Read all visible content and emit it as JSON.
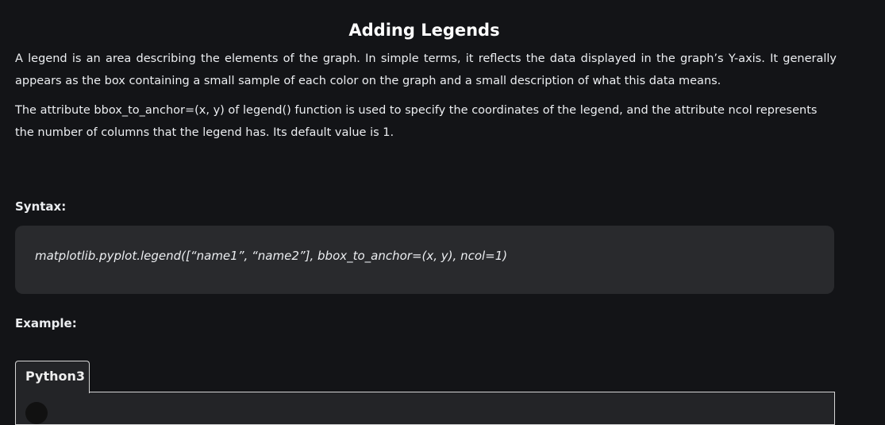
{
  "heading": "Adding Legends",
  "paragraphs": [
    "A legend is an area describing the elements of the graph. In simple terms, it reflects the data displayed in the graph’s Y-axis. It generally appears as the box containing a small sample of each color on the graph and a small description of what this data means.",
    "The attribute bbox_to_anchor=(x, y) of legend() function is used to specify the coordinates of the legend, and the attribute ncol represents the number of columns that the legend has. Its default value is 1."
  ],
  "syntax_label": "Syntax:",
  "syntax_code": "matplotlib.pyplot.legend([“name1”, “name2”], bbox_to_anchor=(x, y), ncol=1)",
  "example_label": "Example:",
  "code_tab": "Python3"
}
